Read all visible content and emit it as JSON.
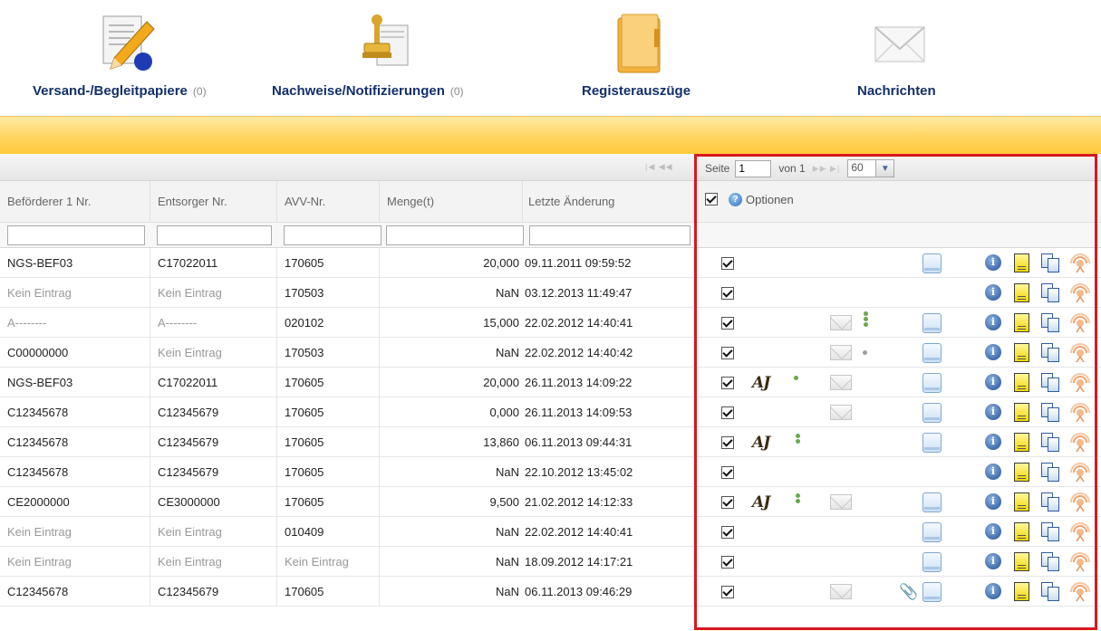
{
  "nav": {
    "items": [
      {
        "label": "Versand-/Begleitpapiere",
        "count": "(0)",
        "icon": "pencil-document-icon"
      },
      {
        "label": "Nachweise/Notifizierungen",
        "count": "(0)",
        "icon": "stamp-document-icon"
      },
      {
        "label": "Registerauszüge",
        "count": "",
        "icon": "folder-icon"
      },
      {
        "label": "Nachrichten",
        "count": "",
        "icon": "envelope-icon"
      }
    ]
  },
  "pager": {
    "page_label": "Seite",
    "page_value": "1",
    "of_label": "von 1",
    "rows_per_page": "60"
  },
  "options": {
    "label": "Optionen"
  },
  "columns": [
    "Beförderer 1 Nr.",
    "Entsorger Nr.",
    "AVV-Nr.",
    "Menge(t)",
    "Letzte Änderung"
  ],
  "rows": [
    {
      "carrier": "NGS-BEF03",
      "disposer": "C17022011",
      "avv": "170605",
      "amount": "20,000",
      "changed": "09.11.2011 09:59:52"
    },
    {
      "carrier": "Kein Eintrag",
      "disposer": "Kein Eintrag",
      "avv": "170503",
      "amount": "NaN",
      "changed": "03.12.2013 11:49:47"
    },
    {
      "carrier": "A--------",
      "disposer": "A--------",
      "avv": "020102",
      "amount": "15,000",
      "changed": "22.02.2012 14:40:41"
    },
    {
      "carrier": "C00000000",
      "disposer": "Kein Eintrag",
      "avv": "170503",
      "amount": "NaN",
      "changed": "22.02.2012 14:40:42"
    },
    {
      "carrier": "NGS-BEF03",
      "disposer": "C17022011",
      "avv": "170605",
      "amount": "20,000",
      "changed": "26.11.2013 14:09:22"
    },
    {
      "carrier": "C12345678",
      "disposer": "C12345679",
      "avv": "170605",
      "amount": "0,000",
      "changed": "26.11.2013 14:09:53"
    },
    {
      "carrier": "C12345678",
      "disposer": "C12345679",
      "avv": "170605",
      "amount": "13,860",
      "changed": "06.11.2013 09:44:31"
    },
    {
      "carrier": "C12345678",
      "disposer": "C12345679",
      "avv": "170605",
      "amount": "NaN",
      "changed": "22.10.2012 13:45:02"
    },
    {
      "carrier": "CE2000000",
      "disposer": "CE3000000",
      "avv": "170605",
      "amount": "9,500",
      "changed": "21.02.2012 14:12:33"
    },
    {
      "carrier": "Kein Eintrag",
      "disposer": "Kein Eintrag",
      "avv": "010409",
      "amount": "NaN",
      "changed": "22.02.2012 14:40:41"
    },
    {
      "carrier": "Kein Eintrag",
      "disposer": "Kein Eintrag",
      "avv": "Kein Eintrag",
      "amount": "NaN",
      "changed": "18.09.2012 14:17:21"
    },
    {
      "carrier": "C12345678",
      "disposer": "C12345679",
      "avv": "170605",
      "amount": "NaN",
      "changed": "06.11.2013 09:46:29"
    }
  ],
  "row_actions": [
    {
      "signature": false,
      "status_dots": 0,
      "message": false,
      "attachment": false,
      "document": true
    },
    {
      "signature": false,
      "status_dots": 0,
      "message": false,
      "attachment": false,
      "document": false
    },
    {
      "signature": false,
      "status_dots": 3,
      "message": true,
      "attachment": false,
      "document": true
    },
    {
      "signature": false,
      "status_dots": 1,
      "message": true,
      "attachment": false,
      "document": true
    },
    {
      "signature": true,
      "status_dots": 1,
      "message": true,
      "attachment": false,
      "document": true
    },
    {
      "signature": false,
      "status_dots": 0,
      "message": true,
      "attachment": false,
      "document": true
    },
    {
      "signature": true,
      "status_dots": 2,
      "message": false,
      "attachment": false,
      "document": true
    },
    {
      "signature": false,
      "status_dots": 0,
      "message": false,
      "attachment": false,
      "document": false
    },
    {
      "signature": true,
      "status_dots": 2,
      "message": true,
      "attachment": false,
      "document": true
    },
    {
      "signature": false,
      "status_dots": 0,
      "message": false,
      "attachment": false,
      "document": true
    },
    {
      "signature": false,
      "status_dots": 0,
      "message": false,
      "attachment": false,
      "document": true
    },
    {
      "signature": false,
      "status_dots": 0,
      "message": true,
      "attachment": true,
      "document": true
    }
  ],
  "colors": {
    "accent_bar": "#ffd35a",
    "nav_text": "#13306b",
    "highlight_frame": "#d71920",
    "dim_text": "#999999"
  }
}
